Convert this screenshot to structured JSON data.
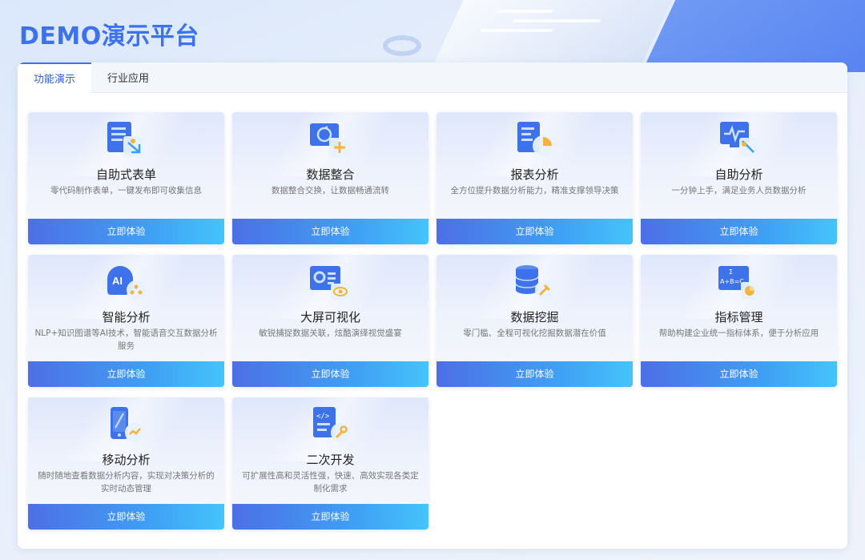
{
  "app": {
    "title": "DEMO演示平台"
  },
  "tabs": [
    {
      "label": "功能演示",
      "active": true
    },
    {
      "label": "行业应用",
      "active": false
    }
  ],
  "cards": [
    {
      "icon": "form-icon",
      "title": "自助式表单",
      "desc": "零代码制作表单，一键发布即可收集信息",
      "button": "立即体验"
    },
    {
      "icon": "data-integration-icon",
      "title": "数据整合",
      "desc": "数据整合交换，让数据畅通流转",
      "button": "立即体验"
    },
    {
      "icon": "report-icon",
      "title": "报表分析",
      "desc": "全方位提升数据分析能力，精准支撑领导决策",
      "button": "立即体验"
    },
    {
      "icon": "self-analysis-icon",
      "title": "自助分析",
      "desc": "一分钟上手，满足业务人员数据分析",
      "button": "立即体验"
    },
    {
      "icon": "ai-icon",
      "title": "智能分析",
      "desc": "NLP+知识图谱等AI技术，智能语音交互数据分析服务",
      "button": "立即体验"
    },
    {
      "icon": "big-screen-icon",
      "title": "大屏可视化",
      "desc": "敏锐捕捉数据关联，炫酷演绎视觉盛宴",
      "button": "立即体验"
    },
    {
      "icon": "database-mining-icon",
      "title": "数据挖掘",
      "desc": "零门槛、全程可视化挖掘数据潜在价值",
      "button": "立即体验"
    },
    {
      "icon": "formula-icon",
      "title": "指标管理",
      "desc": "帮助构建企业统一指标体系，便于分析应用",
      "button": "立即体验"
    },
    {
      "icon": "mobile-icon",
      "title": "移动分析",
      "desc": "随时随地查看数据分析内容，实现对决策分析的实时动态管理",
      "button": "立即体验"
    },
    {
      "icon": "code-dev-icon",
      "title": "二次开发",
      "desc": "可扩展性高和灵活性强，快速、高效实现各类定制化需求",
      "button": "立即体验"
    }
  ],
  "colors": {
    "accent": "#3d72ea",
    "button_start": "#4d6fe6",
    "button_end": "#45c4fb"
  }
}
